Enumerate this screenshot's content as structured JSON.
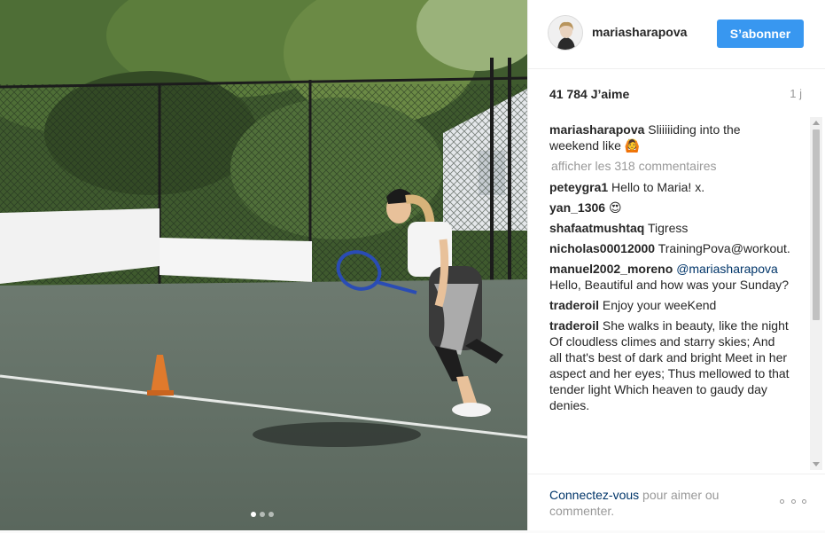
{
  "post": {
    "username": "mariasharapova",
    "follow_label": "S’abonner",
    "likes": "41 784 J’aime",
    "time_ago": "1 j",
    "caption": {
      "author": "mariasharapova",
      "text": "Sliiiiiding into the weekend like 🙆"
    },
    "load_more": "afficher les 318 commentaires",
    "comments": [
      {
        "author": "peteygra1",
        "text": "Hello to Maria! x."
      },
      {
        "author": "yan_1306",
        "text": "😍"
      },
      {
        "author": "shafaatmushtaq",
        "text": "Tigress"
      },
      {
        "author": "nicholas00012000",
        "text": "TrainingPova@workout."
      },
      {
        "author": "manuel2002_moreno",
        "mention": "@mariasharapova",
        "text": "Hello, Beautiful and how was your Sunday?"
      },
      {
        "author": "traderoil",
        "text": "Enjoy your weeKend"
      },
      {
        "author": "traderoil",
        "text": "She walks in beauty, like the night Of cloudless climes and starry skies; And all that's best of dark and bright Meet in her aspect and her eyes; Thus mellowed to that tender light Which heaven to gaudy day denies."
      }
    ],
    "footer": {
      "login_link": "Connectez-vous",
      "login_text": " pour aimer ou commenter."
    },
    "media_dots": 3
  },
  "icons": {
    "more": "more-options-icon",
    "avatar": "avatar"
  },
  "colors": {
    "accent": "#3897f0",
    "link": "#003569",
    "muted": "#999999",
    "text": "#262626"
  }
}
